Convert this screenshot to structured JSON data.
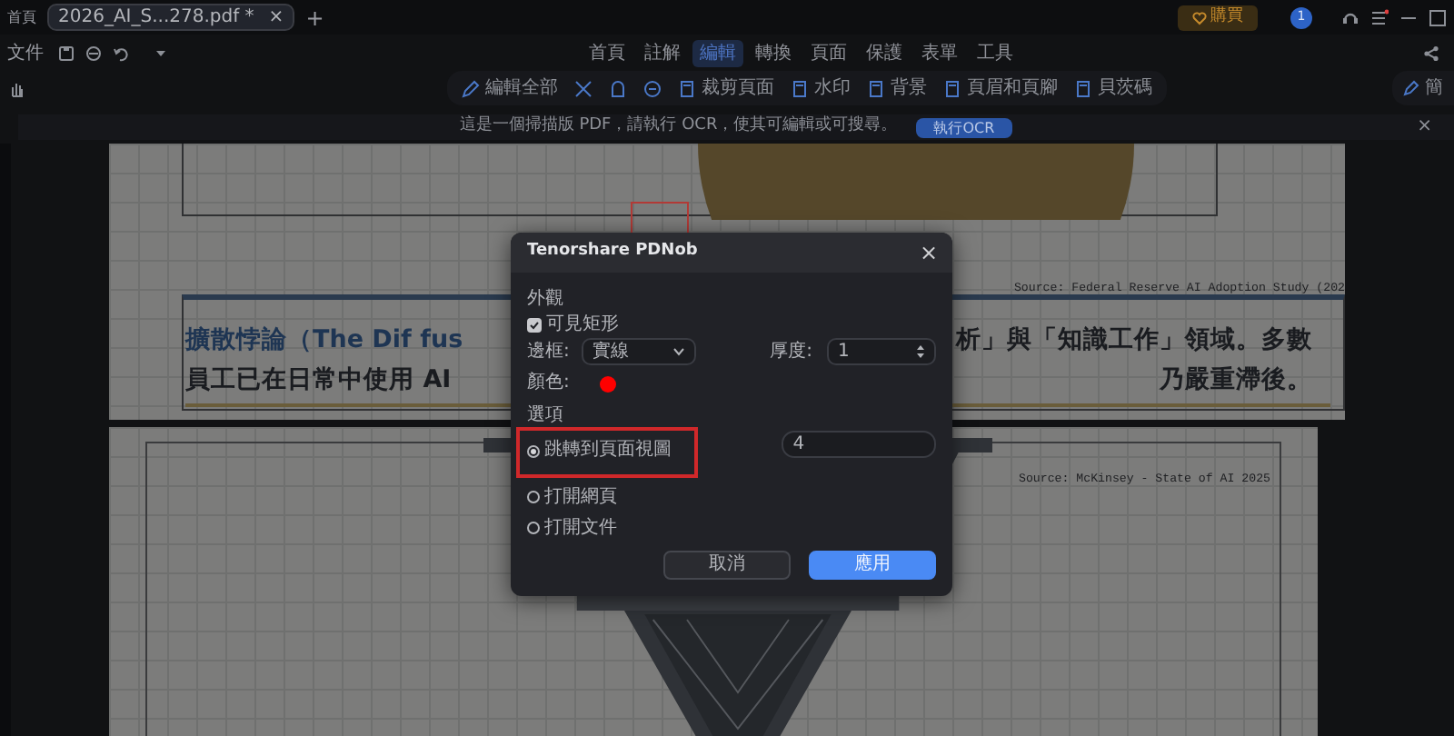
{
  "title_bar": {
    "home_tab": "首頁",
    "file_tab": {
      "label": "2026_AI_S...278.pdf *",
      "selected": true
    },
    "tab_close": "×",
    "new_tab": "+",
    "buy_button": "購買",
    "avatar": "1"
  },
  "menu_bar": {
    "file_menu": "文件",
    "tabs": [
      {
        "label": "首頁",
        "selected": false
      },
      {
        "label": "註解",
        "selected": false
      },
      {
        "label": "編輯",
        "selected": true
      },
      {
        "label": "轉換",
        "selected": false
      },
      {
        "label": "頁面",
        "selected": false
      },
      {
        "label": "保護",
        "selected": false
      },
      {
        "label": "表單",
        "selected": false
      },
      {
        "label": "工具",
        "selected": false
      }
    ]
  },
  "toolbar": {
    "items": [
      {
        "kind": "labeled",
        "label": "編輯全部"
      },
      {
        "kind": "icon"
      },
      {
        "kind": "icon"
      },
      {
        "kind": "icon"
      },
      {
        "kind": "labeled",
        "label": "裁剪頁面"
      },
      {
        "kind": "labeled",
        "label": "水印"
      },
      {
        "kind": "labeled",
        "label": "背景"
      },
      {
        "kind": "labeled",
        "label": "頁眉和頁腳"
      },
      {
        "kind": "labeled",
        "label": "貝茨碼"
      }
    ],
    "right_button": "簡"
  },
  "notice": {
    "message": "這是一個掃描版 PDF，請執行 OCR，使其可編輯或可搜尋。",
    "button": "執行OCR",
    "close": "×"
  },
  "document": {
    "pages": [
      {
        "kind": "text-page",
        "source": "Source: Federal Reserve AI Adoption Study (202",
        "lines": [
          {
            "left": "擴散悖論（The Dif fus",
            "right": "析」與「知識工作」領域。多數"
          },
          {
            "left": "員工已在日常中使用 AI",
            "right": "乃嚴重滯後。"
          }
        ]
      },
      {
        "kind": "emblem-page",
        "source": "Source: McKinsey - State of AI 2025"
      }
    ]
  },
  "dialog": {
    "title": "Tenorshare PDNob",
    "close": "×",
    "appearance_heading": "外觀",
    "visible_rect": {
      "label": "可見矩形",
      "checked": true
    },
    "border": {
      "label": "邊框:",
      "value": "實線"
    },
    "thickness": {
      "label": "厚度:",
      "value": "1"
    },
    "color": {
      "label": "顏色:",
      "color": "#ff0000"
    },
    "action_heading": "選項",
    "actions": [
      {
        "label": "跳轉到頁面視圖",
        "selected": true
      },
      {
        "label": "打開網頁",
        "selected": false
      },
      {
        "label": "打開文件",
        "selected": false
      }
    ],
    "page_value": "4",
    "cancel": "取消",
    "apply": "應用"
  }
}
